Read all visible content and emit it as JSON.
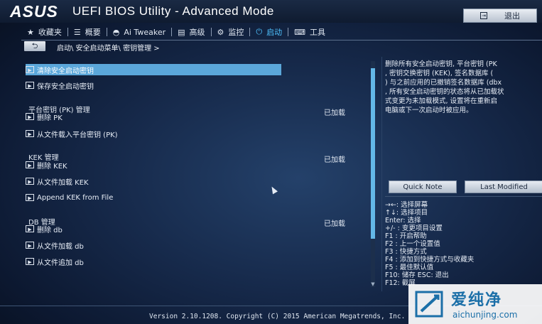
{
  "header": {
    "logo": "ASUS",
    "title": "UEFI BIOS Utility - Advanced Mode",
    "exit_label": "退出"
  },
  "tabs": [
    {
      "icon": "star-icon",
      "glyph": "★",
      "label": "收藏夹"
    },
    {
      "icon": "list-icon",
      "glyph": "☰",
      "label": "概要"
    },
    {
      "icon": "tweaker-icon",
      "glyph": "◓",
      "label": "Ai Tweaker"
    },
    {
      "icon": "advanced-icon",
      "glyph": "▤",
      "label": "高级"
    },
    {
      "icon": "monitor-icon",
      "glyph": "⚙",
      "label": "监控"
    },
    {
      "icon": "power-icon",
      "glyph": "⏻",
      "label": "启动",
      "active": true
    },
    {
      "icon": "tool-icon",
      "glyph": "⌨",
      "label": "工具"
    }
  ],
  "breadcrumb": "启动\\ 安全启动菜单\\ 密钥管理 >",
  "main": {
    "items": [
      {
        "label": "清除安全启动密钥",
        "highlight": true
      },
      {
        "label": "保存安全启动密钥"
      }
    ],
    "pk": {
      "title": "平台密钥 (PK) 管理",
      "status": "已加载",
      "items": [
        "删除 PK",
        "从文件载入平台密钥 (PK)"
      ]
    },
    "kek": {
      "title": "KEK 管理",
      "status": "已加载",
      "items": [
        "删除 KEK",
        "从文件加载 KEK",
        "Append KEK from File"
      ]
    },
    "db": {
      "title": "DB 管理",
      "status": "已加载",
      "items": [
        "删除 db",
        "从文件加载 db",
        "从文件追加 db"
      ]
    }
  },
  "help_lines": [
    "删除所有安全启动密钥, 平台密钥 (PK",
    ", 密钥交换密钥 (KEK), 签名数据库 (",
    ") 与之前应用的已撤销签名数据库 (dbx",
    ", 所有安全启动密钥的状态将从已加载状",
    "式变更为未加载模式, 设置将在重新启",
    "电脑或下一次启动时被应用。"
  ],
  "buttons": {
    "quick_note": "Quick Note",
    "last_modified": "Last Modified"
  },
  "keys": [
    "→←: 选择屏幕",
    "↑↓: 选择项目",
    "Enter: 选择",
    "+/- : 变更项目设置",
    "F1 : 开启帮助",
    "F2 : 上一个设置值",
    "F3 : 快捷方式",
    "F4 : 添加到快捷方式与收藏夹",
    "F5 : 最佳默认值",
    "F10: 储存  ESC: 退出",
    "F12: 截屏"
  ],
  "footer": "Version 2.10.1208. Copyright (C) 2015 American Megatrends, Inc.",
  "watermark": {
    "brand": "爱纯净",
    "url": "aichunjing.com"
  }
}
